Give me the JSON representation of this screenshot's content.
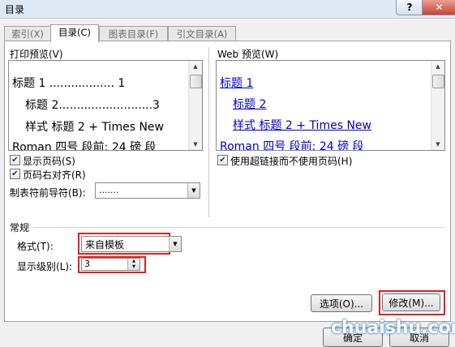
{
  "window": {
    "title": "目录",
    "help": "?",
    "close": "✕"
  },
  "tabs": [
    {
      "label": "索引(X)",
      "active": false
    },
    {
      "label": "目录(C)",
      "active": true
    },
    {
      "label": "图表目录(F)",
      "active": false
    },
    {
      "label": "引文目录(A)",
      "active": false
    }
  ],
  "print_preview": {
    "label": "打印预览(V)",
    "lines": [
      "标题 1 .................. 1",
      "标题 2..........................3",
      "样式 标题 2 + Times New",
      "Roman 四号 段前: 24 磅 段"
    ],
    "show_page_numbers": {
      "label": "显示页码(S)",
      "checked": true
    },
    "right_align": {
      "label": "页码右对齐(R)",
      "checked": true
    },
    "tab_leader": {
      "label": "制表符前导符(B):",
      "value": "......."
    }
  },
  "web_preview": {
    "label": "Web 预览(W)",
    "lines": [
      "标题 1",
      "标题 2",
      "样式 标题 2 + Times New",
      "Roman 四号 段前: 24 磅 段"
    ],
    "use_hyperlinks": {
      "label": "使用超链接而不使用页码(H)",
      "checked": true
    }
  },
  "general": {
    "section_label": "常规",
    "format": {
      "label": "格式(T):",
      "value": "来自模板"
    },
    "levels": {
      "label": "显示级别(L):",
      "value": "3"
    }
  },
  "buttons": {
    "options": "选项(O)...",
    "modify": "修改(M)...",
    "ok": "确定",
    "cancel": "取消"
  },
  "watermark": "chuaishu.com",
  "colors": {
    "highlight": "#e02020",
    "link": "#0000d4"
  }
}
